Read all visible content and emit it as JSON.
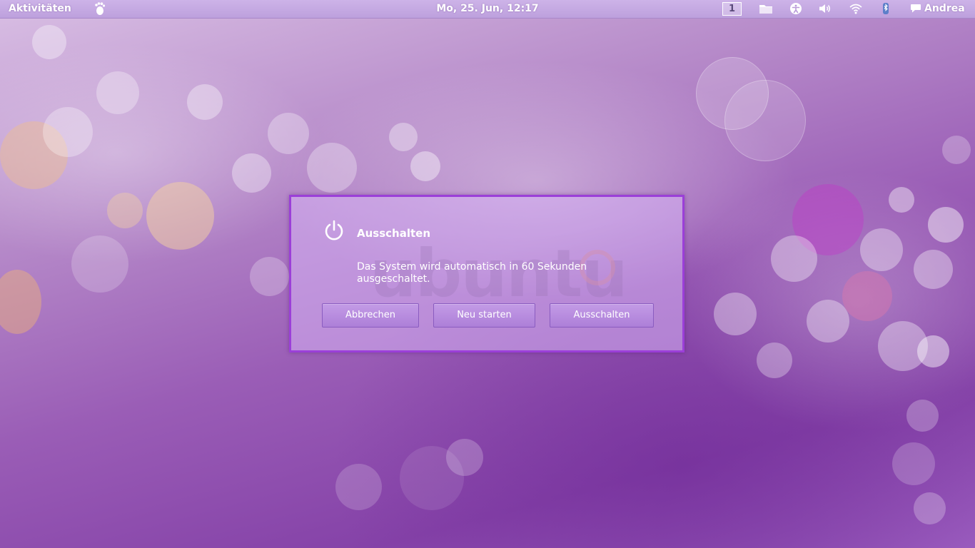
{
  "top_panel": {
    "activities_label": "Aktivitäten",
    "clock": "Mo, 25. Jun, 12:17",
    "workspace_number": "1",
    "user_name": "Andrea",
    "icons": [
      "gnome-foot-icon",
      "files-icon",
      "accessibility-icon",
      "volume-icon",
      "wifi-icon",
      "bluetooth-icon",
      "chat-icon"
    ]
  },
  "dialog": {
    "icon": "power-icon",
    "title": "Ausschalten",
    "message": "Das System wird automatisch in 60 Sekunden ausgeschaltet.",
    "buttons": {
      "cancel": "Abbrechen",
      "restart": "Neu starten",
      "shutdown": "Ausschalten"
    }
  },
  "colors": {
    "panel": "#bda0dd",
    "dialog_border": "#9b3fd8",
    "button": "#ad7fd8",
    "text": "#ffffff"
  }
}
